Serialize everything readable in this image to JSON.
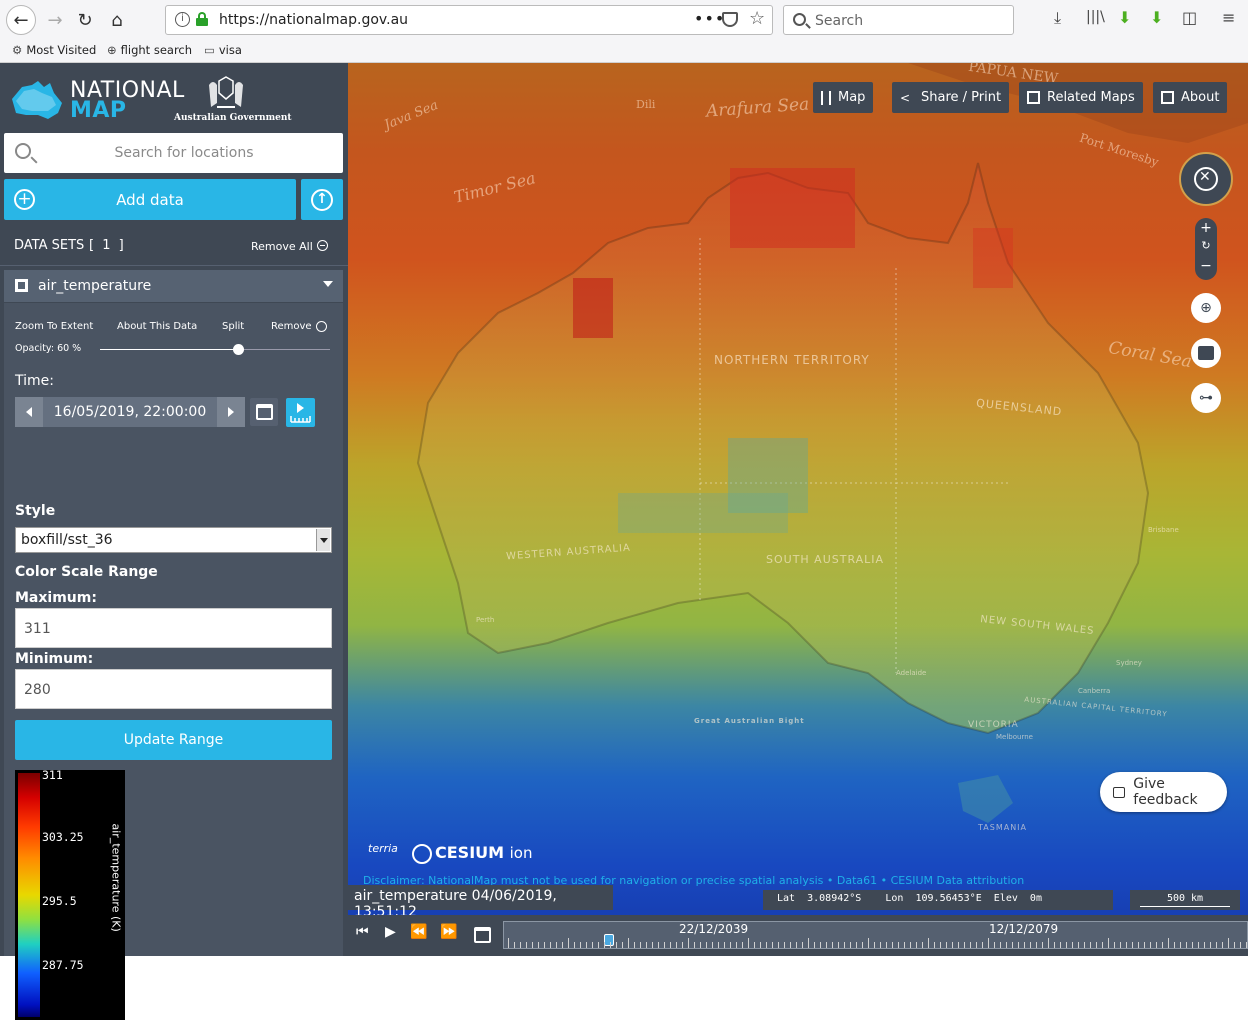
{
  "browser": {
    "url": "https://nationalmap.gov.au",
    "search_placeholder": "Search",
    "bookmarks": [
      "Most Visited",
      "flight search",
      "visa"
    ]
  },
  "sidebar": {
    "logo_line1": "NATIONAL",
    "logo_line2": "MAP",
    "gov_label": "Australian Government",
    "search_placeholder": "Search for locations",
    "add_data_label": "Add data",
    "datasets_title": "DATA SETS",
    "datasets_count": "[ 1 ]",
    "remove_all_label": "Remove All",
    "dataset": {
      "name": "air_temperature",
      "zoom_to_extent": "Zoom To Extent",
      "about_this_data": "About This Data",
      "split": "Split",
      "remove": "Remove",
      "opacity_label": "Opacity: 60 %",
      "opacity_value": 0.6,
      "time_label": "Time:",
      "time_value": "16/05/2019, 22:00:00",
      "style_label": "Style",
      "style_value": "boxfill/sst_36",
      "color_scale_label": "Color Scale Range",
      "maximum_label": "Maximum:",
      "maximum_value": "311",
      "minimum_label": "Minimum:",
      "minimum_value": "280",
      "update_range_label": "Update Range",
      "legend": {
        "title": "air_temperature (K)",
        "ticks": [
          "311",
          "303.25",
          "295.5",
          "287.75"
        ]
      }
    }
  },
  "map": {
    "buttons": {
      "map": "Map",
      "share": "Share / Print",
      "related": "Related Maps",
      "about": "About"
    },
    "labels": {
      "sea1": "Arafura Sea",
      "sea2": "Timor Sea",
      "sea3": "Java Sea",
      "sea4": "Coral Sea",
      "city1": "Dili",
      "city2": "Port Moresby",
      "region1": "PAPUA NEW",
      "state_nt": "NORTHERN TERRITORY",
      "state_qld": "QUEENSLAND",
      "state_wa": "WESTERN AUSTRALIA",
      "state_sa": "SOUTH AUSTRALIA",
      "state_nsw": "NEW SOUTH WALES",
      "state_vic": "VICTORIA",
      "state_tas": "TASMANIA",
      "act": "AUSTRALIAN CAPITAL TERRITORY",
      "bight": "Great Australian Bight",
      "adelaide": "Adelaide",
      "melbourne": "Melbourne",
      "sydney": "Sydney",
      "canberra": "Canberra",
      "brisbane": "Brisbane",
      "perth": "Perth"
    },
    "feedback_label": "Give feedback",
    "terria_label": "terria",
    "cesium_label": "CESIUM",
    "cesium_ion": "ion",
    "disclaimer": "Disclaimer: NationalMap must not be used for navigation or precise spatial analysis • Data61 • CESIUM  Data attribution"
  },
  "timeline": {
    "current_label": "air_temperature 04/06/2019, 13:51:12",
    "lat_label": "Lat",
    "lat_value": "3.08942°S",
    "lon_label": "Lon",
    "lon_value": "109.56453°E",
    "elev_label": "Elev",
    "elev_value": "0m",
    "scale_label": "500 km",
    "date1": "22/12/2039",
    "date2": "12/12/2079"
  },
  "colors": {
    "accent": "#29b6e6",
    "panel": "#3f4854"
  }
}
